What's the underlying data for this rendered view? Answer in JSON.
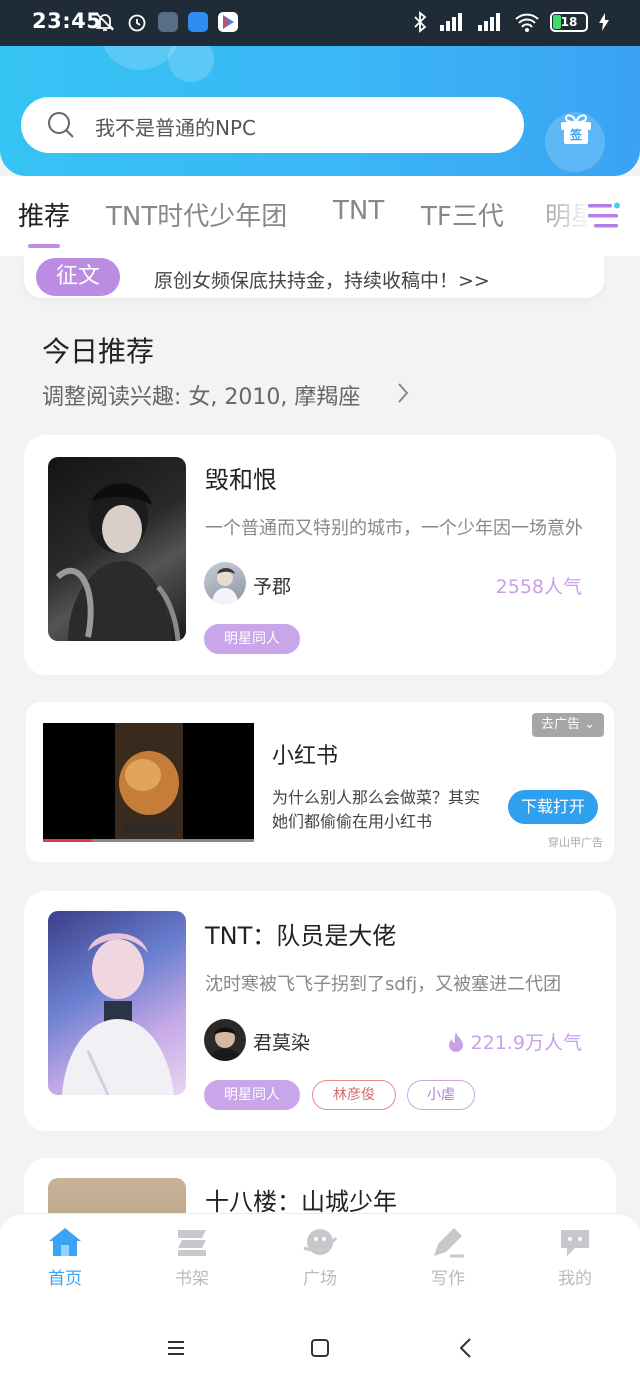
{
  "status_bar": {
    "time": "23:45",
    "battery": "18"
  },
  "search": {
    "placeholder": "我不是普通的NPC"
  },
  "checkin": {
    "label": "签"
  },
  "tabs": [
    {
      "label": "推荐"
    },
    {
      "label": "TNT时代少年团"
    },
    {
      "label": "TNT"
    },
    {
      "label": "TF三代"
    },
    {
      "label": "明星"
    }
  ],
  "notice": {
    "badge": "征文",
    "text": "原创女频保底扶持金，持续收稿中！>>"
  },
  "today": {
    "title": "今日推荐",
    "subtitle": "调整阅读兴趣: 女, 2010, 摩羯座"
  },
  "books": [
    {
      "title": "毁和恨",
      "desc": "一个普通而又特别的城市，一个少年因一场意外",
      "author": "予郡",
      "popularity": "2558人气",
      "tags": [
        "明星同人"
      ]
    },
    {
      "title": "TNT：队员是大佬",
      "desc": "沈时寒被飞飞子拐到了sdfj，又被塞进二代团",
      "author": "君莫染",
      "popularity": "221.9万人气",
      "tags": [
        "明星同人",
        "林彦俊",
        "小虐"
      ]
    },
    {
      "title": "十八楼：山城少年"
    }
  ],
  "ad": {
    "title": "小红书",
    "desc": "为什么别人那么会做菜？其实她们都偷偷在用小红书",
    "close_label": "去广告",
    "button": "下载打开",
    "source": "穿山甲广告",
    "video_progress": 0.23
  },
  "bottom_nav": [
    {
      "label": "首页",
      "icon": "home-icon"
    },
    {
      "label": "书架",
      "icon": "bookshelf-icon"
    },
    {
      "label": "广场",
      "icon": "planet-icon"
    },
    {
      "label": "写作",
      "icon": "pen-icon"
    },
    {
      "label": "我的",
      "icon": "chat-bubble-icon"
    }
  ],
  "colors": {
    "accent": "#3aa3f3",
    "purple": "#c08de6",
    "tag_red": "#e88a8a"
  }
}
